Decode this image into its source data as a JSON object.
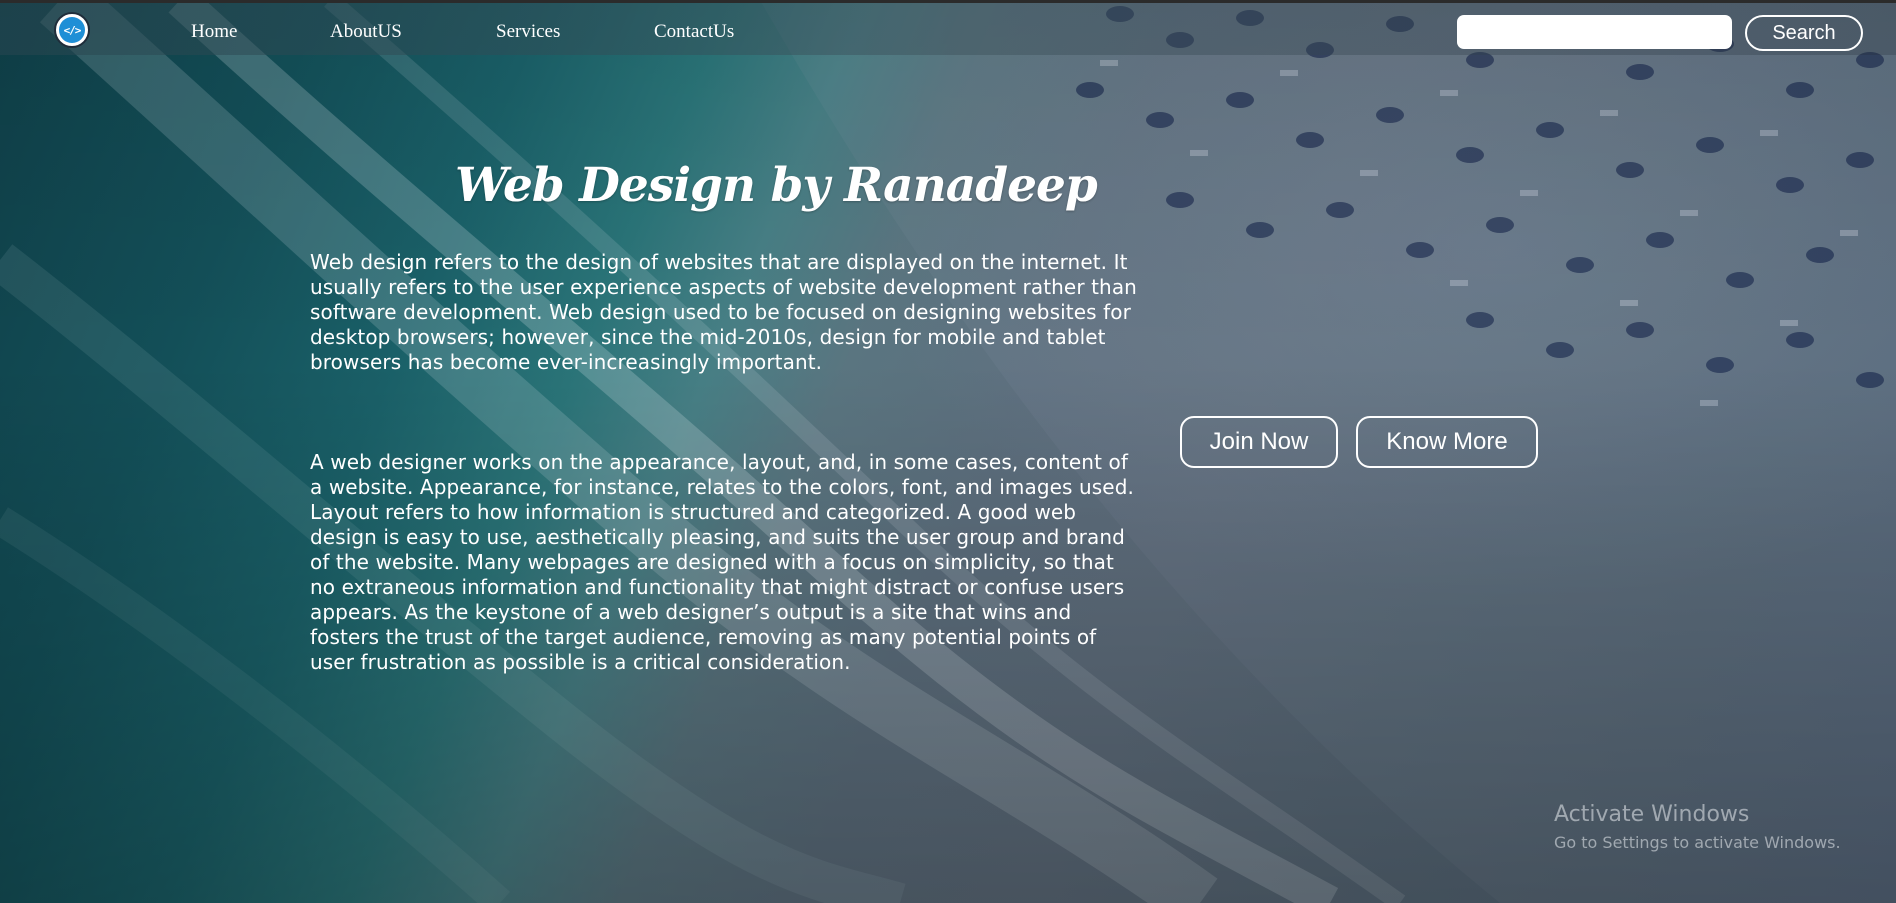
{
  "navbar": {
    "logo_symbol": "</>",
    "logo_icon": "code-icon",
    "links": [
      "Home",
      "AboutUS",
      "Services",
      "ContactUs"
    ],
    "search": {
      "value": "",
      "placeholder": "",
      "button_label": "Search"
    }
  },
  "main": {
    "title": "Web Design by Ranadeep",
    "paragraphs": [
      "Web design refers to the design of websites that are displayed on the internet. It usually refers to the user experience aspects of website development rather than software development. Web design used to be focused on designing websites for desktop browsers; however, since the mid-2010s, design for mobile and tablet browsers has become ever-increasingly important.",
      "A web designer works on the appearance, layout, and, in some cases, content of a website. Appearance, for instance, relates to the colors, font, and images used. Layout refers to how information is structured and categorized. A good web design is easy to use, aesthetically pleasing, and suits the user group and brand of the website. Many webpages are designed with a focus on simplicity, so that no extraneous information and functionality that might distract or confuse users appears. As the keystone of a web designer’s output is a site that wins and fosters the trust of the target audience, removing as many potential points of user frustration as possible is a critical consideration."
    ],
    "buttons": {
      "join": "Join Now",
      "know_more": "Know More"
    }
  },
  "watermark": {
    "title": "Activate Windows",
    "subtitle": "Go to Settings to activate Windows."
  },
  "colors": {
    "logo_blue": "#1f8fd6",
    "text": "#ffffff"
  }
}
